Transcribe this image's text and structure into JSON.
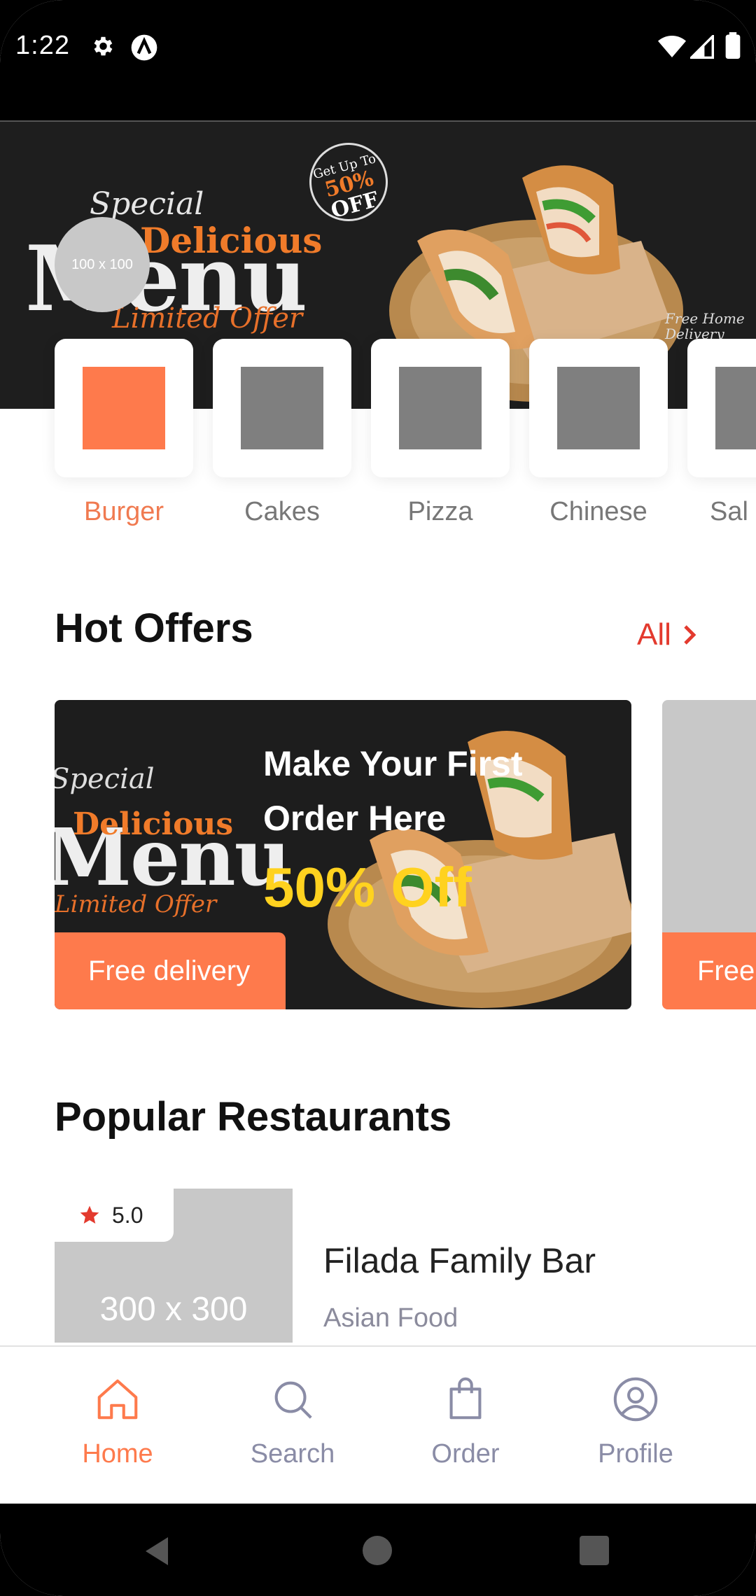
{
  "status_bar": {
    "time": "1:22"
  },
  "banner": {
    "special_text": "Special",
    "delicious_text": "Delicious",
    "menu_text": "Menu",
    "limited_text": "Limited Offer",
    "badge_top": "Get Up To",
    "badge_percent": "50%",
    "badge_off": "OFF",
    "free_home": "Free Home Delivery",
    "avatar_placeholder": "100 x 100"
  },
  "categories": [
    {
      "label": "Burger",
      "active": true
    },
    {
      "label": "Cakes",
      "active": false
    },
    {
      "label": "Pizza",
      "active": false
    },
    {
      "label": "Chinese",
      "active": false
    },
    {
      "label": "Sal",
      "active": false
    }
  ],
  "hot_offers": {
    "title": "Hot Offers",
    "see_all": "All",
    "offers": [
      {
        "special_text": "Special",
        "delicious_text": "Delicious",
        "menu_text": "Menu",
        "limited_text": "Limited Offer",
        "title": "Make Your First Order Here",
        "discount": "50%  Off",
        "delivery": "Free delivery"
      },
      {
        "delivery": "Free"
      }
    ]
  },
  "popular_restaurants": {
    "title": "Popular Restaurants",
    "items": [
      {
        "image_placeholder": "300 x 300",
        "rating": "5.0",
        "name": "Filada Family Bar",
        "type": "Asian Food"
      }
    ]
  },
  "bottom_nav": {
    "items": [
      {
        "label": "Home",
        "icon": "home-icon",
        "active": true
      },
      {
        "label": "Search",
        "icon": "search-icon",
        "active": false
      },
      {
        "label": "Order",
        "icon": "shopping-bag-icon",
        "active": false
      },
      {
        "label": "Profile",
        "icon": "profile-icon",
        "active": false
      }
    ]
  },
  "colors": {
    "accent": "#fe7a4c",
    "see_all": "#e33a2e",
    "discount": "#ffd21f",
    "muted": "#8a8ca6"
  }
}
